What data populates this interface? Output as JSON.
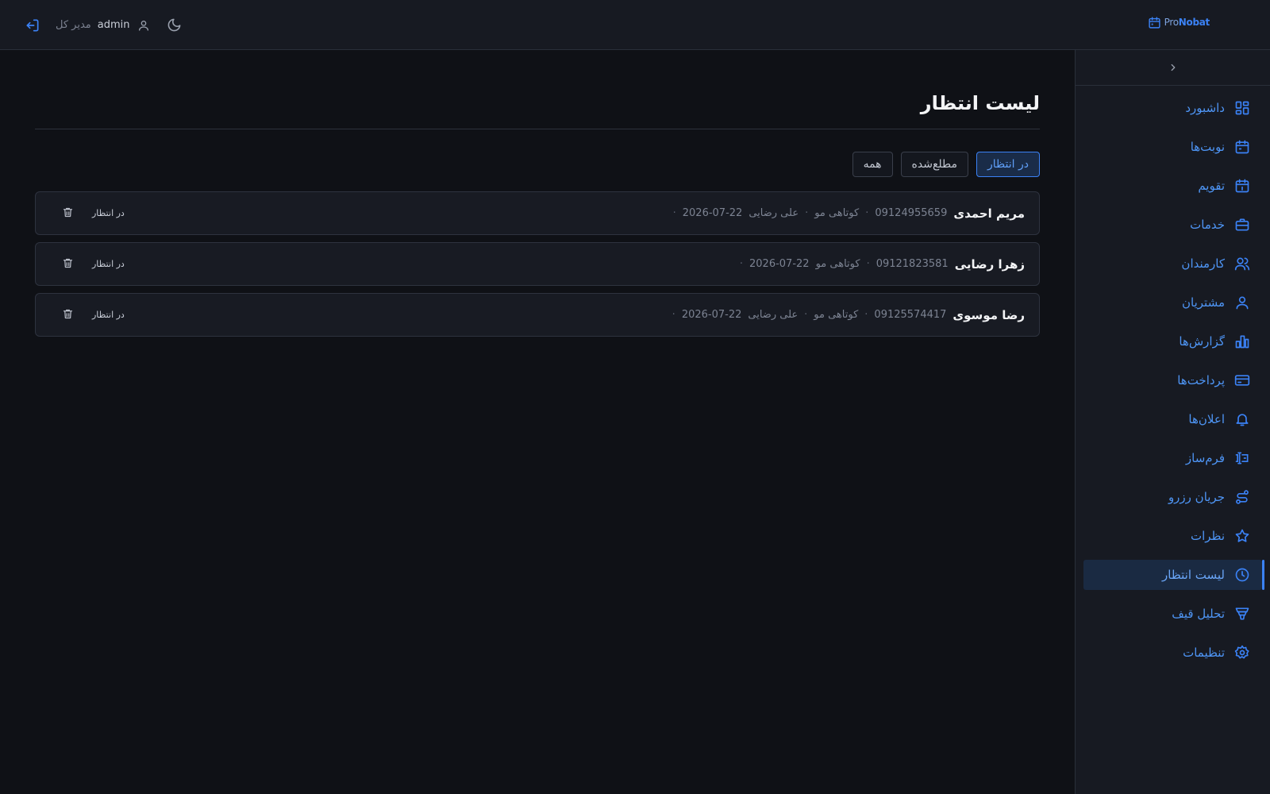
{
  "header": {
    "brand": {
      "pre": "Pro",
      "bold": "Nobat"
    },
    "user": "admin",
    "role": "مدیر کل"
  },
  "sidebar": {
    "items": [
      {
        "label": "داشبورد",
        "icon": "dashboard-icon",
        "active": false
      },
      {
        "label": "نوبت‌ها",
        "icon": "calendar-icon",
        "active": false
      },
      {
        "label": "تقویم",
        "icon": "calendar-day-icon",
        "active": false
      },
      {
        "label": "خدمات",
        "icon": "briefcase-icon",
        "active": false
      },
      {
        "label": "کارمندان",
        "icon": "users-icon",
        "active": false
      },
      {
        "label": "مشتریان",
        "icon": "user-icon",
        "active": false
      },
      {
        "label": "گزارش‌ها",
        "icon": "bar-chart-icon",
        "active": false
      },
      {
        "label": "پرداخت‌ها",
        "icon": "credit-card-icon",
        "active": false
      },
      {
        "label": "اعلان‌ها",
        "icon": "bell-icon",
        "active": false
      },
      {
        "label": "فرم‌ساز",
        "icon": "form-builder-icon",
        "active": false
      },
      {
        "label": "جریان رزرو",
        "icon": "workflow-icon",
        "active": false
      },
      {
        "label": "نظرات",
        "icon": "star-icon",
        "active": false
      },
      {
        "label": "لیست انتظار",
        "icon": "clock-icon",
        "active": true
      },
      {
        "label": "تحلیل قیف",
        "icon": "funnel-icon",
        "active": false
      },
      {
        "label": "تنظیمات",
        "icon": "gear-icon",
        "active": false
      }
    ]
  },
  "main": {
    "title": "لیست انتظار",
    "tabs": [
      {
        "label": "در انتظار",
        "active": true
      },
      {
        "label": "مطلع‌شده",
        "active": false
      },
      {
        "label": "همه",
        "active": false
      }
    ],
    "entries": [
      {
        "name": "مریم احمدی",
        "phone": "09124955659",
        "service": "کوتاهی مو",
        "staff": "علی رضایی",
        "date": "2026-07-22",
        "status": "در انتظار"
      },
      {
        "name": "زهرا رضایی",
        "phone": "09121823581",
        "service": "کوتاهی مو",
        "staff": "",
        "date": "2026-07-22",
        "status": "در انتظار"
      },
      {
        "name": "رضا موسوی",
        "phone": "09125574417",
        "service": "کوتاهی مو",
        "staff": "علی رضایی",
        "date": "2026-07-22",
        "status": "در انتظار"
      }
    ]
  },
  "colors": {
    "accent": "#3b82f6",
    "background": "#0f1116",
    "panel": "#171a22"
  }
}
